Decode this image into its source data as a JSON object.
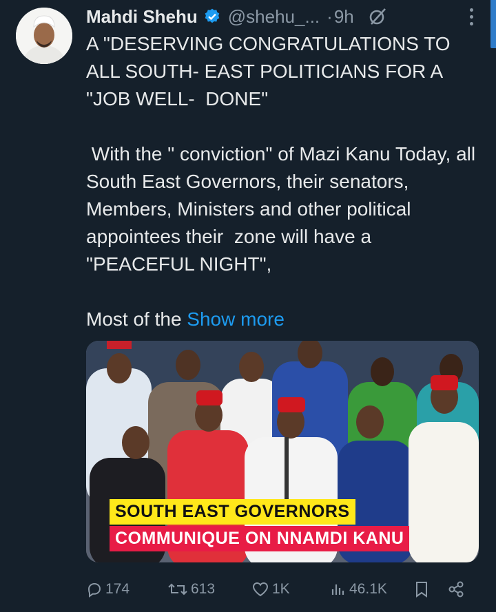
{
  "tweet": {
    "author_name": "Mahdi Shehu",
    "handle": "@shehu_...",
    "separator": "·",
    "time": "9h",
    "text": "A \"DESERVING CONGRATULATIONS TO ALL SOUTH- EAST POLITICIANS FOR A \"JOB WELL-  DONE\"\n\n With the \" conviction\" of Mazi Kanu Today, all South East Governors, their senators, Members, Ministers and other political appointees their  zone will have a \"PEACEFUL NIGHT\",\n\nMost of the ",
    "show_more": "Show more"
  },
  "media": {
    "banner_line1": "SOUTH EAST GOVERNORS",
    "banner_line2": "COMMUNIQUE ON NNAMDI KANU"
  },
  "actions": {
    "replies": "174",
    "reposts": "613",
    "likes": "1K",
    "views": "46.1K"
  },
  "colors": {
    "background": "#15202b",
    "accent": "#1d9bf0",
    "muted": "#8b98a5",
    "banner_yellow": "#ffe81a",
    "banner_red": "#e81c46"
  },
  "icons": [
    "verified-badge-icon",
    "grok-icon",
    "more-options-icon",
    "reply-icon",
    "repost-icon",
    "like-icon",
    "views-icon",
    "bookmark-icon",
    "share-icon"
  ]
}
